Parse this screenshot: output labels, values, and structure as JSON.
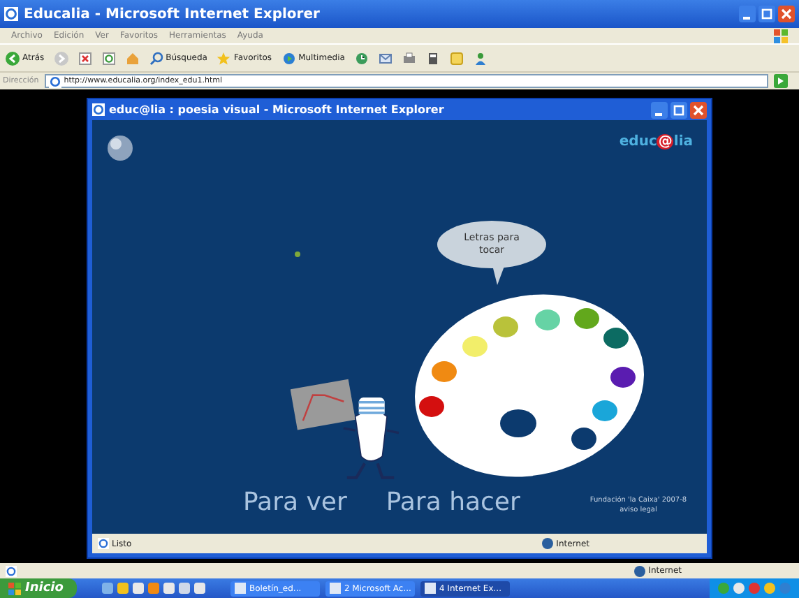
{
  "window": {
    "title": "Educalia - Microsoft Internet Explorer"
  },
  "menu": [
    "Archivo",
    "Edición",
    "Ver",
    "Favoritos",
    "Herramientas",
    "Ayuda"
  ],
  "toolbar": [
    {
      "kind": "back",
      "label": "Atrás"
    },
    {
      "kind": "forward"
    },
    {
      "kind": "stop"
    },
    {
      "kind": "refresh"
    },
    {
      "kind": "home"
    },
    {
      "kind": "search",
      "label": "Búsqueda"
    },
    {
      "kind": "favorites",
      "label": "Favoritos"
    },
    {
      "kind": "media",
      "label": "Multimedia"
    },
    {
      "kind": "history"
    },
    {
      "kind": "mail"
    },
    {
      "kind": "print"
    },
    {
      "kind": "edit"
    },
    {
      "kind": "note"
    },
    {
      "kind": "messenger"
    }
  ],
  "address": {
    "label": "Dirección",
    "value": "http://www.educalia.org/index_edu1.html"
  },
  "popup": {
    "title": "educ@lia : poesia visual - Microsoft Internet Explorer",
    "logo": [
      "educ",
      "@",
      "lia"
    ],
    "bubble": "Letras para tocar",
    "links": [
      "Para ver",
      "Para hacer"
    ],
    "footer": "Fundación 'la Caixa' 2007-8 aviso legal",
    "status": "Listo",
    "zone": "Internet"
  },
  "status_bar": {
    "zone": "Internet"
  },
  "taskbar": {
    "start": "Inicio",
    "tasks": [
      {
        "label": "Boletín_ed...",
        "selected": false
      },
      {
        "label": "2 Microsoft Ac...",
        "selected": false
      },
      {
        "label": "4 Internet Ex...",
        "selected": true
      }
    ]
  }
}
